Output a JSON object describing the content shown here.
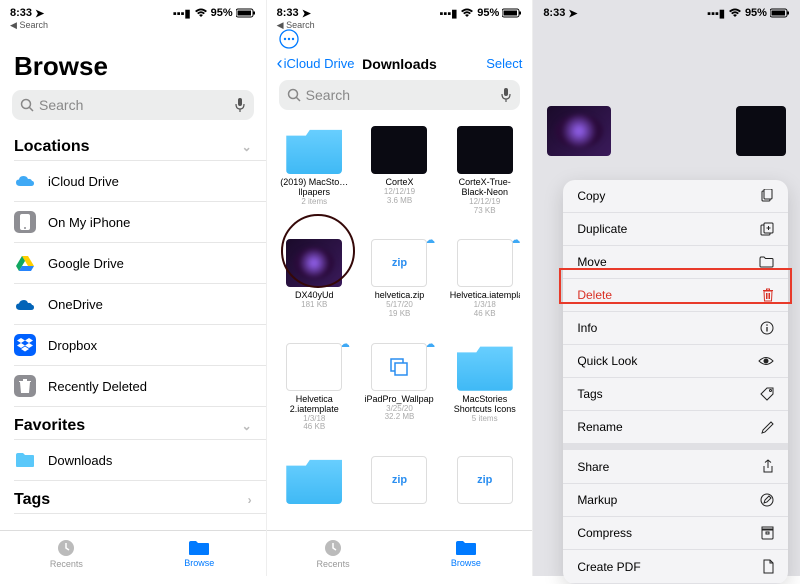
{
  "status": {
    "time": "8:33",
    "battery": "95%"
  },
  "back_search_label": "Search",
  "screen1": {
    "title": "Browse",
    "search_placeholder": "Search",
    "sections": {
      "locations": "Locations",
      "favorites": "Favorites",
      "tags": "Tags"
    },
    "locations": [
      {
        "label": "iCloud Drive"
      },
      {
        "label": "On My iPhone"
      },
      {
        "label": "Google Drive"
      },
      {
        "label": "OneDrive"
      },
      {
        "label": "Dropbox"
      },
      {
        "label": "Recently Deleted"
      }
    ],
    "favorites": [
      {
        "label": "Downloads"
      }
    ]
  },
  "tabs": {
    "recents": "Recents",
    "browse": "Browse"
  },
  "screen2": {
    "back": "iCloud Drive",
    "title": "Downloads",
    "select": "Select",
    "search_placeholder": "Search",
    "items": [
      {
        "name": "(2019) MacSto…llpapers",
        "meta": "2 items",
        "kind": "folder"
      },
      {
        "name": "CorteX",
        "meta1": "12/12/19",
        "meta2": "3.6 MB",
        "kind": "dark"
      },
      {
        "name": "CorteX-True-Black-Neon",
        "meta1": "12/12/19",
        "meta2": "73 KB",
        "kind": "dark"
      },
      {
        "name": "DX40yUd",
        "meta2": "181 KB",
        "kind": "img"
      },
      {
        "name": "helvetica.zip",
        "meta1": "5/17/20",
        "meta2": "19 KB",
        "kind": "zip",
        "cloud": true
      },
      {
        "name": "Helvetica.iatemplate",
        "meta1": "1/3/18",
        "meta2": "46 KB",
        "kind": "file",
        "cloud": true
      },
      {
        "name": "Helvetica 2.iatemplate",
        "meta1": "1/3/18",
        "meta2": "46 KB",
        "kind": "file",
        "cloud": true
      },
      {
        "name": "iPadPro_Wallpaper",
        "meta1": "3/25/20",
        "meta2": "32.2 MB",
        "kind": "copy",
        "cloud": true
      },
      {
        "name": "MacStories Shortcuts Icons",
        "meta": "5 items",
        "kind": "folder"
      }
    ],
    "zip_label": "zip"
  },
  "screen3": {
    "menu": [
      {
        "label": "Copy",
        "icon": "copy"
      },
      {
        "label": "Duplicate",
        "icon": "duplicate"
      },
      {
        "label": "Move",
        "icon": "folder"
      },
      {
        "label": "Delete",
        "icon": "trash",
        "red": true
      },
      {
        "label": "Info",
        "icon": "info"
      },
      {
        "label": "Quick Look",
        "icon": "eye"
      },
      {
        "label": "Tags",
        "icon": "tag"
      },
      {
        "label": "Rename",
        "icon": "pencil"
      },
      {
        "label": "Share",
        "icon": "share"
      },
      {
        "label": "Markup",
        "icon": "markup"
      },
      {
        "label": "Compress",
        "icon": "archive"
      },
      {
        "label": "Create PDF",
        "icon": "pdf"
      }
    ]
  }
}
